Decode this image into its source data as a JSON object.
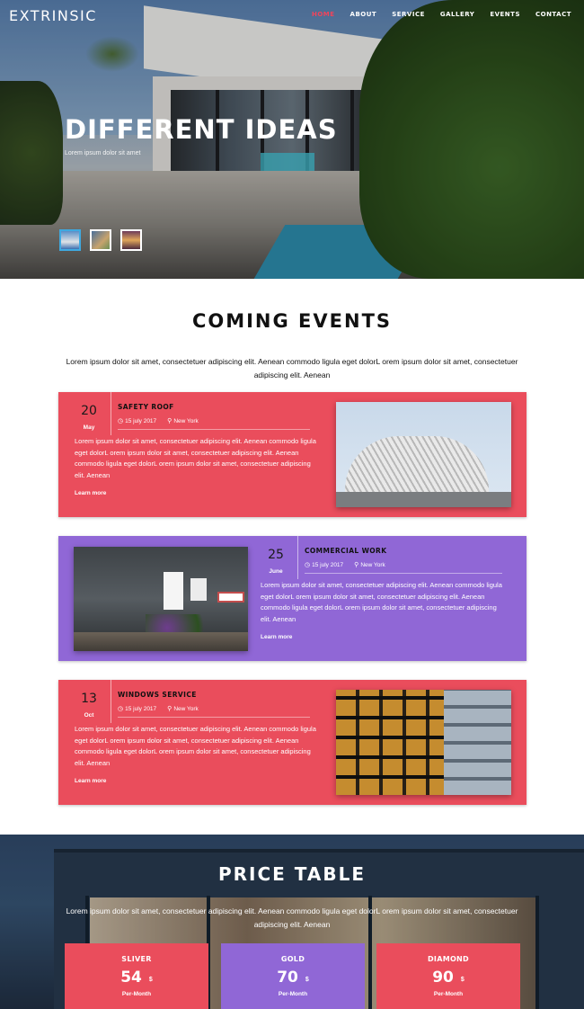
{
  "brand": {
    "logo": "EXTRINSIC"
  },
  "nav": {
    "items": [
      "HOME",
      "ABOUT",
      "SERVICE",
      "GALLERY",
      "EVENTS",
      "CONTACT"
    ]
  },
  "hero": {
    "title": "DIFFERENT IDEAS",
    "subtitle": "Lorem ipsum dolor sit amet"
  },
  "events": {
    "title": "COMING EVENTS",
    "intro": "Lorem ipsum dolor sit amet, consectetuer adipiscing elit. Aenean commodo ligula eget dolorL orem ipsum dolor sit amet, consectetuer adipiscing elit. Aenean",
    "items": [
      {
        "day": "20",
        "month": "May",
        "title": "SAFETY ROOF",
        "date": "15 july 2017",
        "location": "New York",
        "body": "Lorem ipsum dolor sit amet, consectetuer adipiscing elit. Aenean commodo ligula eget dolorL orem ipsum dolor sit amet, consectetuer adipiscing elit. Aenean commodo ligula eget dolorL orem ipsum dolor sit amet, consectetuer adipiscing elit. Aenean",
        "more": "Learn more",
        "color": "#ea4d5c"
      },
      {
        "day": "25",
        "month": "June",
        "title": "COMMERCIAL WORK",
        "date": "15 july 2017",
        "location": "New York",
        "body": "Lorem ipsum dolor sit amet, consectetuer adipiscing elit. Aenean commodo ligula eget dolorL orem ipsum dolor sit amet, consectetuer adipiscing elit. Aenean commodo ligula eget dolorL orem ipsum dolor sit amet, consectetuer adipiscing elit. Aenean",
        "more": "Learn more",
        "color": "#9067d6"
      },
      {
        "day": "13",
        "month": "Oct",
        "title": "WINDOWS SERVICE",
        "date": "15 july 2017",
        "location": "New York",
        "body": "Lorem ipsum dolor sit amet, consectetuer adipiscing elit. Aenean commodo ligula eget dolorL orem ipsum dolor sit amet, consectetuer adipiscing elit. Aenean commodo ligula eget dolorL orem ipsum dolor sit amet, consectetuer adipiscing elit. Aenean",
        "more": "Learn more",
        "color": "#ea4d5c"
      }
    ]
  },
  "price": {
    "title": "PRICE TABLE",
    "intro": "Lorem ipsum dolor sit amet, consectetuer adipiscing elit. Aenean commodo ligula eget dolorL orem ipsum dolor sit amet, consectetuer adipiscing elit. Aenean",
    "plans": [
      {
        "name": "SLIVER",
        "value": "54",
        "currency": "$",
        "period": "Per-Month",
        "color": "#ea4d5c"
      },
      {
        "name": "GOLD",
        "value": "70",
        "currency": "$",
        "period": "Per-Month",
        "color": "#9067d6"
      },
      {
        "name": "DIAMOND",
        "value": "90",
        "currency": "$",
        "period": "Per-Month",
        "color": "#ea4d5c"
      }
    ]
  },
  "icons": {
    "clock": "clock-icon",
    "pin": "map-pin-icon"
  },
  "colors": {
    "accent_red": "#ea4d5c",
    "accent_purple": "#9067d6",
    "nav_active": "#f0445b"
  }
}
